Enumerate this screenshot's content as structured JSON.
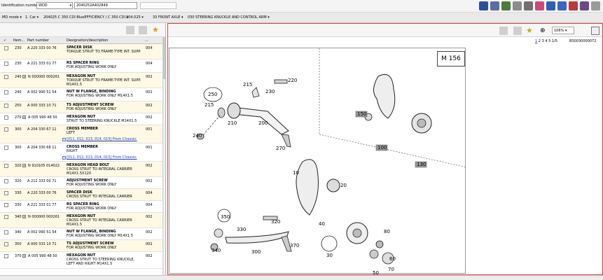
{
  "identification": {
    "label": "Identification number",
    "type_select": "WDD",
    "vin_value": "2040252A402849"
  },
  "breadcrumb": {
    "mode": "MD mode",
    "car": "1. Car",
    "model": "204025 C 350 CDI BlueEFFICIENCY / C 350 CDI",
    "code": "204.025",
    "group": "33 FRONT AXLE",
    "subgroup": "030 STEERING KNUCKLE AND CONTROL ARM"
  },
  "table": {
    "headers": {
      "check": "✓",
      "item": "Item...",
      "part": "Part number",
      "desc": "Designation/description",
      "qty": "..."
    },
    "rows": [
      {
        "item": "230",
        "plus": "",
        "part": "A 220 333 00 76",
        "title": "SPACER DISK",
        "sub": "TORQUE STRUT TO FRAME-TYPE INT. SUPP.",
        "qty": "004"
      },
      {
        "item": "230",
        "plus": "",
        "part": "A 221 333 01 77",
        "title": "RS SPACER RING",
        "sub": "FOR ADJUSTING WORK ONLY",
        "qty": "004"
      },
      {
        "item": "240",
        "plus": "+",
        "part": "N 000000 000261",
        "title": "HEXAGON NUT",
        "sub": "TORQUE STRUT TO FRAME-TYPE INT. SUPP. M14X1.5",
        "qty": "002"
      },
      {
        "item": "240",
        "plus": "",
        "part": "A 002 990 51 54",
        "title": "NUT W FLANGE, BINDING",
        "sub": "FOR ADJUSTING WORK ONLY M14X1.5",
        "qty": "002"
      },
      {
        "item": "250",
        "plus": "",
        "part": "A 000 333 10 71",
        "title": "TS ADJUSTMENT SCREW",
        "sub": "FOR ADJUSTING WORK ONLY",
        "qty": "002"
      },
      {
        "item": "270",
        "plus": "+",
        "part": "A 005 990 48 50",
        "title": "HEXAGON NUT",
        "sub": "STRUT TO STEERING KNUCKLE M14X1.5",
        "qty": "002"
      },
      {
        "item": "300",
        "plus": "",
        "part": "A 204 330 67 11",
        "title": "CROSS MEMBER",
        "sub": "LEFT",
        "qty": "001",
        "link": "[011, 012, 013, 014, 015] From Chassis:"
      },
      {
        "item": "300",
        "plus": "",
        "part": "A 204 330 68 11",
        "title": "CROSS MEMBER",
        "sub": "RIGHT",
        "qty": "001",
        "link": "[011, 012, 013, 014, 015] From Chassis:"
      },
      {
        "item": "320",
        "plus": "+",
        "part": "N 910105 014022",
        "title": "HEXAGON HEAD BOLT",
        "sub": "CROSS STRUT TO INTEGRAL CARRIER M14X1.5X120",
        "qty": "002"
      },
      {
        "item": "320",
        "plus": "",
        "part": "A 212 333 00 71",
        "title": "ADJUSTMENT SCREW",
        "sub": "FOR ADJUSTING WORK ONLY",
        "qty": "002"
      },
      {
        "item": "330",
        "plus": "",
        "part": "A 220 333 00 76",
        "title": "SPACER DISK",
        "sub": "CROSS STRUT TO INTEGRAL CARRIER",
        "qty": "004"
      },
      {
        "item": "330",
        "plus": "",
        "part": "A 221 333 01 77",
        "title": "RS SPACER RING",
        "sub": "FOR ADJUSTING WORK ONLY",
        "qty": "004"
      },
      {
        "item": "340",
        "plus": "+",
        "part": "N 000000 000261",
        "title": "HEXAGON NUT",
        "sub": "CROSS STRUT TO INTEGRAL CARRIER M14X1.5",
        "qty": "002"
      },
      {
        "item": "340",
        "plus": "",
        "part": "A 002 990 51 54",
        "title": "NUT W FLANGE, BINDING",
        "sub": "FOR ADJUSTING WORK ONLY M14X1.5",
        "qty": "002"
      },
      {
        "item": "350",
        "plus": "",
        "part": "A 000 333 10 71",
        "title": "TS ADJUSTMENT SCREW",
        "sub": "FOR ADJUSTING WORK ONLY",
        "qty": "002"
      },
      {
        "item": "370",
        "plus": "+",
        "part": "A 005 990 48 50",
        "title": "HEXAGON NUT",
        "sub": "CROSS STRUT TO STEERING KNUCKLE, LEFT AND RIGHT M14X1.5",
        "qty": "002"
      }
    ]
  },
  "viewer": {
    "zoom": "106%",
    "pages": [
      "1",
      "2",
      "3",
      "4",
      "5"
    ],
    "page_counter": "1/5",
    "page_id": "B30030000072",
    "model_box": "M 156"
  },
  "callouts": {
    "c220": "220",
    "c215a": "215",
    "c230a": "230",
    "c250": "250",
    "c215b": "215",
    "c210": "210",
    "c200": "200",
    "c240": "240",
    "c270": "270",
    "c150": "150",
    "c100": "100",
    "c130": "130",
    "c10": "10",
    "c20": "20",
    "c350": "350",
    "c320": "320",
    "c330": "330",
    "c340": "340",
    "c300": "300",
    "c370": "370",
    "c40": "40",
    "c80": "80",
    "c30": "30",
    "c60": "60",
    "c50": "50",
    "c70": "70"
  }
}
